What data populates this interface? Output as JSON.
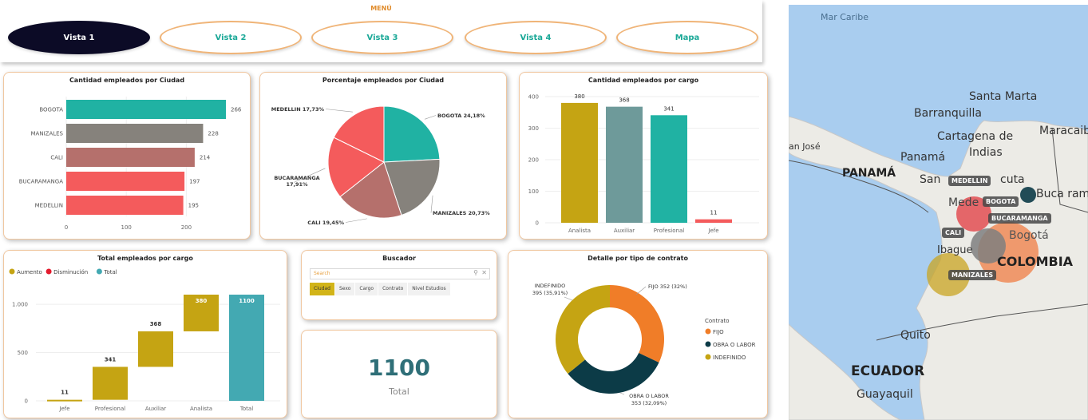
{
  "menu": {
    "title": "MENÚ",
    "buttons": [
      "Vista 1",
      "Vista 2",
      "Vista 3",
      "Vista 4",
      "Mapa"
    ],
    "active_index": 0
  },
  "colors": {
    "teal": "#20b2a3",
    "gray": "#86827c",
    "rose": "#b5706c",
    "coral": "#f45b5c",
    "olive": "#c5a413",
    "slate": "#6e9a9a",
    "orange": "#f07d28",
    "dark_teal": "#0c3b47",
    "total_blue": "#43a9b2",
    "decrease": "#e31b2d"
  },
  "chart_data": [
    {
      "id": "cities_bar",
      "type": "bar",
      "orientation": "horizontal",
      "title": "Cantidad empleados por Ciudad",
      "categories": [
        "BOGOTA",
        "MANIZALES",
        "CALI",
        "BUCARAMANGA",
        "MEDELLIN"
      ],
      "values": [
        266,
        228,
        214,
        197,
        195
      ],
      "xticks": [
        "0",
        "100",
        "200"
      ],
      "xlim": [
        0,
        266
      ]
    },
    {
      "id": "cities_pie",
      "type": "pie",
      "title": "Porcentaje empleados por Ciudad",
      "slices": [
        {
          "label": "BOGOTA 24,18%",
          "value": 24.18
        },
        {
          "label": "MANIZALES 20,73%",
          "value": 20.73
        },
        {
          "label": "CALI 19,45%",
          "value": 19.45
        },
        {
          "label": "BUCARAMANGA 17,91%",
          "value": 17.91
        },
        {
          "label": "MEDELLIN 17,73%",
          "value": 17.73
        }
      ]
    },
    {
      "id": "cargo_bar",
      "type": "bar",
      "title": "Cantidad empleados  por cargo",
      "categories": [
        "Analista",
        "Auxiliar",
        "Profesional",
        "Jefe"
      ],
      "values": [
        380,
        368,
        341,
        11
      ],
      "yticks": [
        "0",
        "100",
        "200",
        "300",
        "400"
      ],
      "ylim": [
        0,
        400
      ]
    },
    {
      "id": "cargo_waterfall",
      "type": "bar",
      "subtype": "waterfall",
      "title": "Total empleados  por cargo",
      "legend": [
        "Aumento",
        "Disminución",
        "Total"
      ],
      "categories": [
        "Jefe",
        "Profesional",
        "Auxiliar",
        "Analista",
        "Total"
      ],
      "values": [
        11,
        341,
        368,
        380,
        1100
      ],
      "yticks": [
        "0",
        "500",
        "1.000"
      ],
      "ylim": [
        0,
        1100
      ]
    },
    {
      "id": "contract_donut",
      "type": "pie",
      "subtype": "donut",
      "title": "Detalle por tipo de contrato",
      "slices": [
        {
          "name": "FIJO",
          "label": "FIJO 352 (32%)",
          "value": 352
        },
        {
          "name": "OBRA O LABOR",
          "label_line1": "OBRA O LABOR",
          "label_line2": "353 (32,09%)",
          "value": 353
        },
        {
          "name": "INDEFINIDO",
          "label_line1": "INDEFINIDO",
          "label_line2": "395 (35,91%)",
          "value": 395
        }
      ],
      "legend_title": "Contrato",
      "legend": [
        "FIJO",
        "OBRA O LABOR",
        "INDEFINIDO"
      ]
    }
  ],
  "search": {
    "title": "Buscador",
    "placeholder": "Search",
    "tabs": [
      "Ciudad",
      "Sexo",
      "Cargo",
      "Contrato",
      "Nivel Estudios"
    ]
  },
  "kpi": {
    "value": "1100",
    "label": "Total"
  },
  "map": {
    "labels": [
      {
        "text": "Mar Caribe"
      },
      {
        "text": "Santa Marta"
      },
      {
        "text": "Barranquilla"
      },
      {
        "text": "Cartagena de"
      },
      {
        "text": "Indias"
      },
      {
        "text": "Maracaibo"
      },
      {
        "text": "an José"
      },
      {
        "text": "Panamá"
      },
      {
        "text": "PANAMÁ"
      },
      {
        "text": "San"
      },
      {
        "text": "cuta"
      },
      {
        "text": "Buca ram"
      },
      {
        "text": "Mede"
      },
      {
        "text": "Bogotá"
      },
      {
        "text": "Ibague"
      },
      {
        "text": "COLOMBIA"
      },
      {
        "text": "Quito"
      },
      {
        "text": "ECUADOR"
      },
      {
        "text": "Guayaquil"
      }
    ],
    "cities": [
      {
        "tag": "MEDELLIN"
      },
      {
        "tag": "BOGOTA"
      },
      {
        "tag": "BUCARAMANGA"
      },
      {
        "tag": "CALI"
      },
      {
        "tag": "MANIZALES"
      }
    ]
  }
}
